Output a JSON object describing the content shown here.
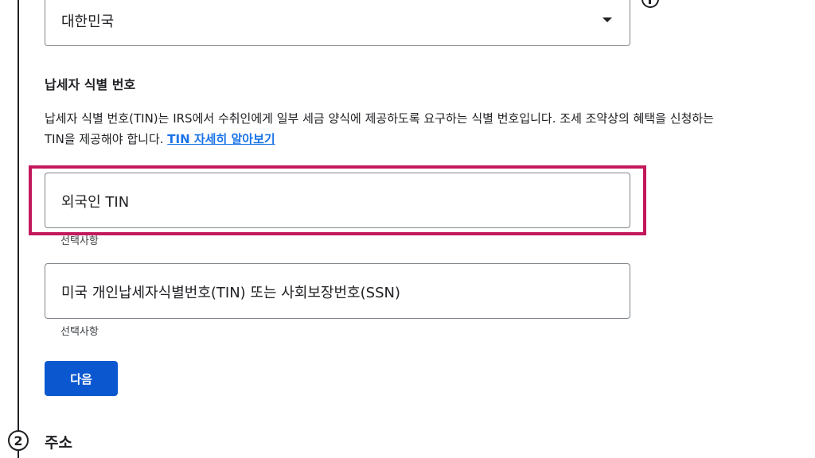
{
  "country_select": {
    "value": "대한민국"
  },
  "tin_section": {
    "title": "납세자 식별 번호",
    "description_line1": "납세자 식별 번호(TIN)는 IRS에서 수취인에게 일부 세금 양식에 제공하도록 요구하는 식별 번호입니다. 조세 조약상의 혜택을 신청하는",
    "description_line2": "TIN을 제공해야 합니다.",
    "learn_more_link": "TIN 자세히 알아보기"
  },
  "foreign_tin": {
    "placeholder": "외국인 TIN",
    "helper": "선택사항"
  },
  "us_tin": {
    "placeholder": "미국 개인납세자식별번호(TIN) 또는 사회보장번호(SSN)",
    "helper": "선택사항"
  },
  "next_button": {
    "label": "다음"
  },
  "next_step": {
    "number": "2",
    "label": "주소"
  },
  "colors": {
    "primary_button": "#0b57d0",
    "link": "#1a73e8",
    "highlight_border": "#c2185b"
  }
}
